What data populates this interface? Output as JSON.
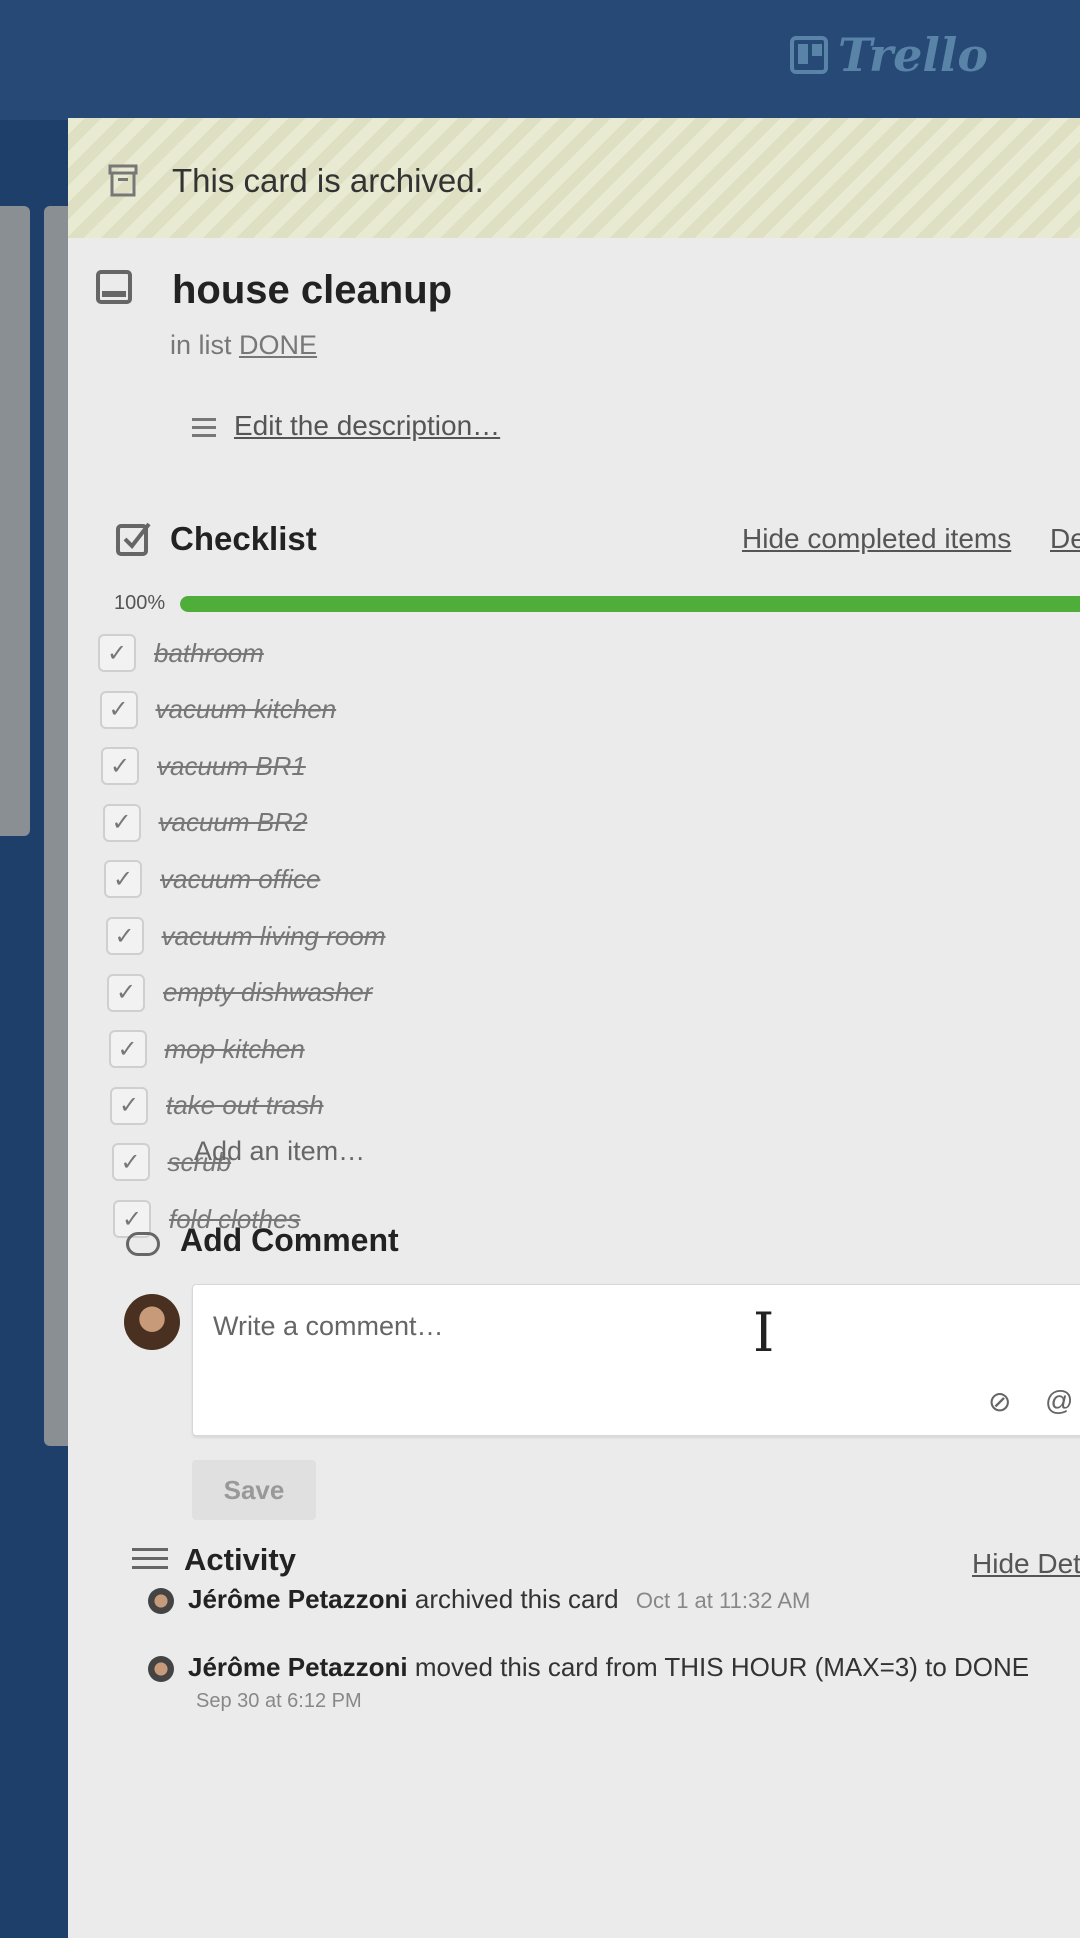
{
  "app": {
    "logo_text": "Trello"
  },
  "banner": {
    "text": "This card is archived."
  },
  "card": {
    "title": "house cleanup",
    "in_list_prefix": "in list",
    "list_name": "DONE",
    "description_link": "Edit the description…"
  },
  "checklist": {
    "title": "Checklist",
    "hide_completed": "Hide completed items",
    "delete_partial": "De",
    "percent_label": "100%",
    "progress": 1.0,
    "progress_color": "#4fad3a",
    "items": [
      {
        "label": "bathroom",
        "checked": true
      },
      {
        "label": "vacuum kitchen",
        "checked": true
      },
      {
        "label": "vacuum BR1",
        "checked": true
      },
      {
        "label": "vacuum BR2",
        "checked": true
      },
      {
        "label": "vacuum office",
        "checked": true
      },
      {
        "label": "vacuum living room",
        "checked": true
      },
      {
        "label": "empty dishwasher",
        "checked": true
      },
      {
        "label": "mop kitchen",
        "checked": true
      },
      {
        "label": "take out trash",
        "checked": true
      },
      {
        "label": "scrub",
        "checked": true
      },
      {
        "label": "fold clothes",
        "checked": true
      }
    ],
    "add_item": "Add an item…"
  },
  "comment": {
    "title": "Add Comment",
    "placeholder": "Write a comment…",
    "save_label": "Save"
  },
  "activity": {
    "title": "Activity",
    "hide_details": "Hide Det",
    "entries": [
      {
        "user": "Jérôme Petazzoni",
        "action": "archived this card",
        "time": "Oct 1 at 11:32 AM"
      },
      {
        "user": "Jérôme Petazzoni",
        "action": "moved this card from THIS HOUR (MAX=3) to DONE",
        "time": "Sep 30 at 6:12 PM"
      }
    ]
  },
  "colors": {
    "board_bg": "#1f3f6b",
    "accent_green": "#4fad3a"
  }
}
